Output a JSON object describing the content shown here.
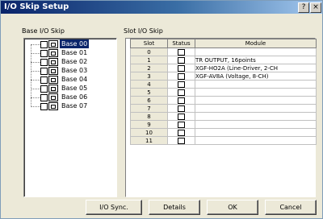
{
  "window": {
    "title": "I/O Skip Setup",
    "help_label": "?",
    "close_label": "×"
  },
  "base_panel": {
    "label": "Base I/O Skip",
    "items": [
      {
        "label": "Base 00",
        "selected": true
      },
      {
        "label": "Base 01"
      },
      {
        "label": "Base 02"
      },
      {
        "label": "Base 03"
      },
      {
        "label": "Base 04"
      },
      {
        "label": "Base 05"
      },
      {
        "label": "Base 06"
      },
      {
        "label": "Base 07"
      }
    ]
  },
  "slot_panel": {
    "label": "Slot I/O Skip",
    "columns": [
      "Slot",
      "Status",
      "Module"
    ],
    "rows": [
      {
        "slot": "0",
        "module": ""
      },
      {
        "slot": "1",
        "module": "TR OUTPUT, 16points"
      },
      {
        "slot": "2",
        "module": "XGF-HO2A (Line-Driver, 2-CH"
      },
      {
        "slot": "3",
        "module": "XGF-AV8A (Voltage, 8-CH)"
      },
      {
        "slot": "4",
        "module": ""
      },
      {
        "slot": "5",
        "module": ""
      },
      {
        "slot": "6",
        "module": ""
      },
      {
        "slot": "7",
        "module": ""
      },
      {
        "slot": "8",
        "module": ""
      },
      {
        "slot": "9",
        "module": ""
      },
      {
        "slot": "10",
        "module": ""
      },
      {
        "slot": "11",
        "module": ""
      }
    ]
  },
  "buttons": {
    "io_sync": "I/O Sync.",
    "details": "Details",
    "ok": "OK",
    "cancel": "Cancel"
  },
  "colors": {
    "titlebar_start": "#0a246a",
    "dialog_bg": "#ece9d8",
    "selection": "#0a246a"
  }
}
